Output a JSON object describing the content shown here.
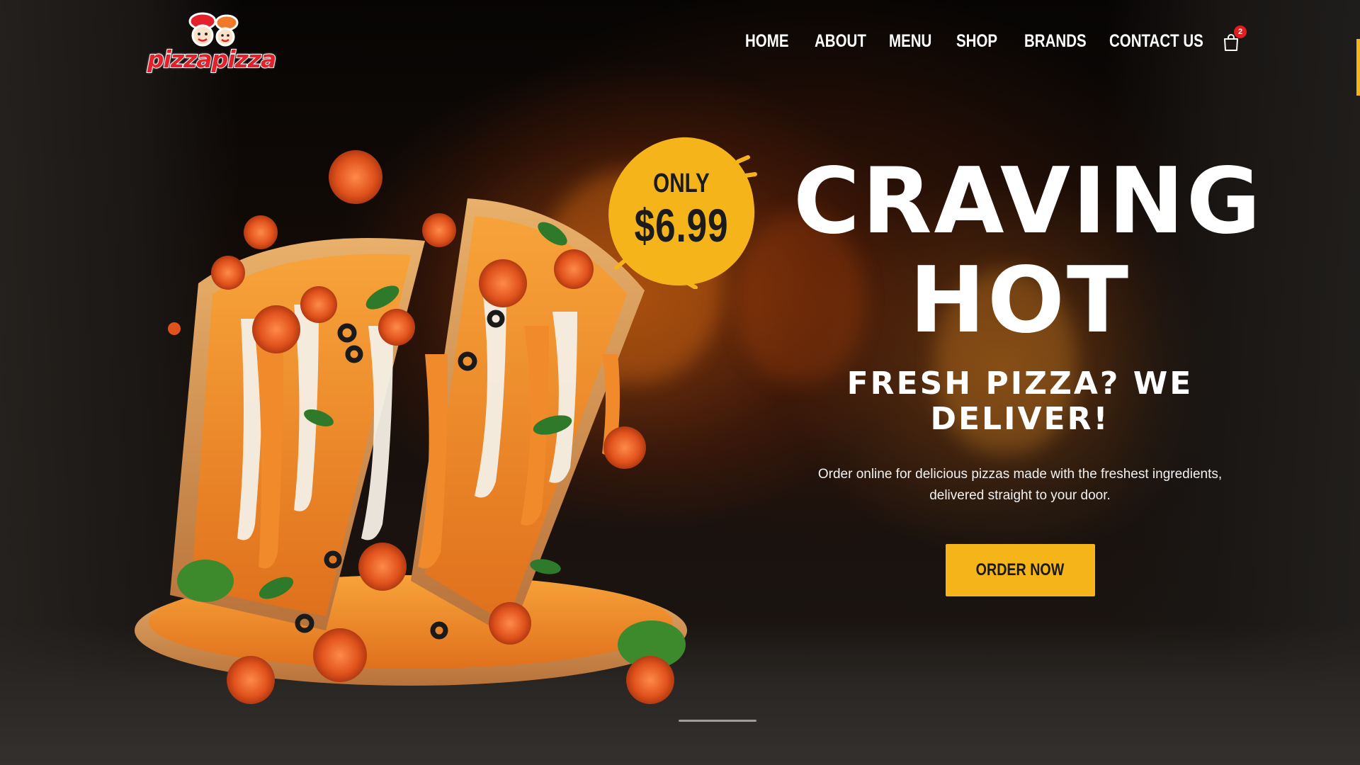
{
  "brand": {
    "logo_text": "pizzapizza",
    "logo_icon": "chef-mascot-icon",
    "accent_color": "#f4b41a",
    "logo_color": "#e4212b"
  },
  "nav": {
    "items": [
      {
        "label": "HOME"
      },
      {
        "label": "ABOUT"
      },
      {
        "label": "MENU"
      },
      {
        "label": "SHOP"
      },
      {
        "label": "BRANDS"
      },
      {
        "label": "CONTACT US"
      }
    ],
    "cart_icon": "shopping-bag-icon",
    "cart_count": "2"
  },
  "promo": {
    "only_label": "ONLY",
    "price": "$6.99",
    "badge_color": "#f4b41a"
  },
  "hero": {
    "title_line1": "CRAVING",
    "title_line2": "HOT",
    "subtitle_line1": "FRESH PIZZA? WE",
    "subtitle_line2": "DELIVER!",
    "description_line1": "Order online for delicious pizzas made with the freshest ingredients,",
    "description_line2": "delivered straight to your door.",
    "cta_label": "ORDER NOW",
    "image_icon": "pizza-slices-illustration"
  }
}
